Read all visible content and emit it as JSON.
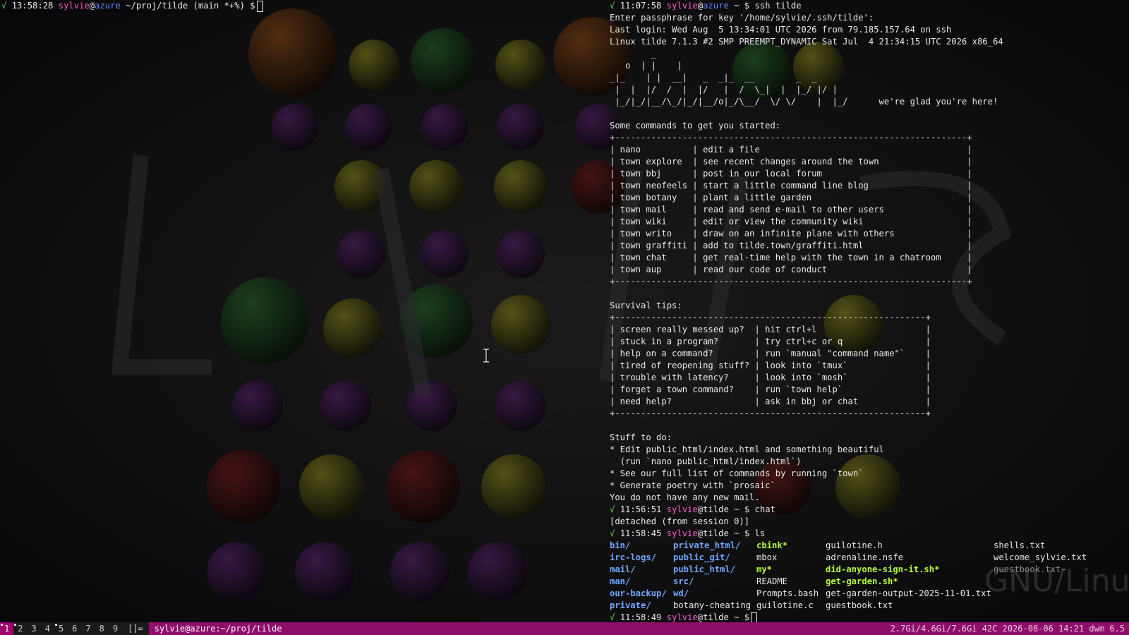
{
  "left_terminal": {
    "prompt": {
      "status": "√",
      "time": "13:58:28",
      "user": "sylvie",
      "at": "@",
      "host": "azure",
      "path": "~/proj/tilde",
      "git": "(main *+%)",
      "symbol": "$"
    }
  },
  "right_terminal": {
    "cmd1": {
      "status": "√",
      "time": "11:07:58",
      "user": "sylvie",
      "at": "@",
      "host": "azure",
      "path": "~",
      "symbol": "$",
      "command": "ssh tilde"
    },
    "intro_lines": [
      "Enter passphrase for key '/home/sylvie/.ssh/tilde':",
      "Last login: Wed Aug  5 13:34:01 UTC 2026 from 79.185.157.64 on ssh",
      "Linux tilde 7.1.3 #2 SMP PREEMPT_DYNAMIC Sat Jul  4 21:34:15 UTC 2026 x86_64"
    ],
    "banner_lines": [
      "        _",
      "   o  | |    |",
      "_|_    | |  __|   _  _|_  __        _  _",
      " |  |  |/  /  |  |/   |  /  \\_|  |  |_/ |/ |",
      " |_/|_/|__/\\_/|_/|__/o|_/\\__/  \\/ \\/    |  |_/      we're glad you're here!"
    ],
    "commands_heading": "Some commands to get you started:",
    "commands_table": [
      "+--------------------------------------------------------------------+",
      "| nano          | edit a file                                        |",
      "| town explore  | see recent changes around the town                 |",
      "| town bbj      | post in our local forum                            |",
      "| town neofeels | start a little command line blog                   |",
      "| town botany   | plant a little garden                              |",
      "| town mail     | read and send e-mail to other users                |",
      "| town wiki     | edit or view the community wiki                    |",
      "| town writo    | draw on an infinite plane with others              |",
      "| town graffiti | add to tilde.town/graffiti.html                    |",
      "| town chat     | get real-time help with the town in a chatroom     |",
      "| town aup      | read our code of conduct                           |",
      "+--------------------------------------------------------------------+"
    ],
    "tips_heading": "Survival tips:",
    "tips_table": [
      "+------------------------------------------------------------+",
      "| screen really messed up?  | hit ctrl+l                     |",
      "| stuck in a program?       | try ctrl+c or q                |",
      "| help on a command?        | run `manual \"command name\"`    |",
      "| tired of reopening stuff? | look into `tmux`               |",
      "| trouble with latency?     | look into `mosh`               |",
      "| forget a town command?    | run `town help`                |",
      "| need help?                | ask in bbj or chat             |",
      "+------------------------------------------------------------+"
    ],
    "todo_heading": "Stuff to do:",
    "todo_lines": [
      "* Edit public_html/index.html and something beautiful",
      "  (run `nano public_html/index.html`)",
      "* See our full list of commands by running `town`",
      "* Generate poetry with `prosaic`",
      "You do not have any new mail."
    ],
    "cmd2": {
      "status": "√",
      "time": "11:56:51",
      "user": "sylvie",
      "at": "@",
      "host": "tilde",
      "path": "~",
      "symbol": "$",
      "command": "chat"
    },
    "detached": "[detached (from session 0)]",
    "cmd3": {
      "status": "√",
      "time": "11:58:45",
      "user": "sylvie",
      "at": "@",
      "host": "tilde",
      "path": "~",
      "symbol": "$",
      "command": "ls"
    },
    "ls_rows": [
      [
        {
          "t": "bin/",
          "k": "dir"
        },
        {
          "t": "private_html/",
          "k": "dir"
        },
        {
          "t": "cbink*",
          "k": "exe"
        },
        {
          "t": "guilotine.h",
          "k": "file"
        },
        {
          "t": "shells.txt",
          "k": "file"
        }
      ],
      [
        {
          "t": "irc-logs/",
          "k": "dir"
        },
        {
          "t": "public_git/",
          "k": "dir"
        },
        {
          "t": "mbox",
          "k": "file"
        },
        {
          "t": "adrenaline.nsfe",
          "k": "file"
        },
        {
          "t": "welcome_sylvie.txt",
          "k": "file"
        }
      ],
      [
        {
          "t": "mail/",
          "k": "dir"
        },
        {
          "t": "public_html/",
          "k": "dir"
        },
        {
          "t": "my*",
          "k": "exe"
        },
        {
          "t": "did-anyone-sign-it.sh*",
          "k": "exe"
        },
        {
          "t": "guestbook.txt~",
          "k": "bak"
        }
      ],
      [
        {
          "t": "man/",
          "k": "dir"
        },
        {
          "t": "src/",
          "k": "dir"
        },
        {
          "t": "README",
          "k": "file"
        },
        {
          "t": "get-garden.sh*",
          "k": "exe"
        },
        {
          "t": "",
          "k": "file"
        }
      ],
      [
        {
          "t": "our-backup/",
          "k": "dir"
        },
        {
          "t": "wd/",
          "k": "dir"
        },
        {
          "t": "Prompts.bash",
          "k": "file"
        },
        {
          "t": "get-garden-output-2025-11-01.txt",
          "k": "file"
        },
        {
          "t": "",
          "k": "file"
        }
      ],
      [
        {
          "t": "private/",
          "k": "dir"
        },
        {
          "t": "botany-cheating",
          "k": "file"
        },
        {
          "t": "guilotine.c",
          "k": "file"
        },
        {
          "t": "guestbook.txt",
          "k": "file"
        },
        {
          "t": "",
          "k": "file"
        }
      ]
    ],
    "cmd4": {
      "status": "√",
      "time": "11:58:49",
      "user": "sylvie",
      "at": "@",
      "host": "tilde",
      "path": "~",
      "symbol": "$"
    }
  },
  "statusbar": {
    "tags": [
      "1",
      "2",
      "3",
      "4",
      "5",
      "6",
      "7",
      "8",
      "9"
    ],
    "active_tag": "1",
    "occupied_tags": [
      "1",
      "2",
      "5"
    ],
    "layout": "[]=",
    "window_title": "sylvie@azure:~/proj/tilde",
    "sysinfo": "2.7Gi/4.6Gi/7.6Gi 42C 2026-08-06 14:21 dwm 6.5"
  },
  "wallpaper": {
    "text_watermark": "GNU/Linux"
  },
  "colors": {
    "accent": "#a0006e",
    "user": "#ff5fd7",
    "host": "#5f87ff",
    "ok": "#5fd75f",
    "dir": "#6fa8ff",
    "exe": "#b4ff3c"
  }
}
